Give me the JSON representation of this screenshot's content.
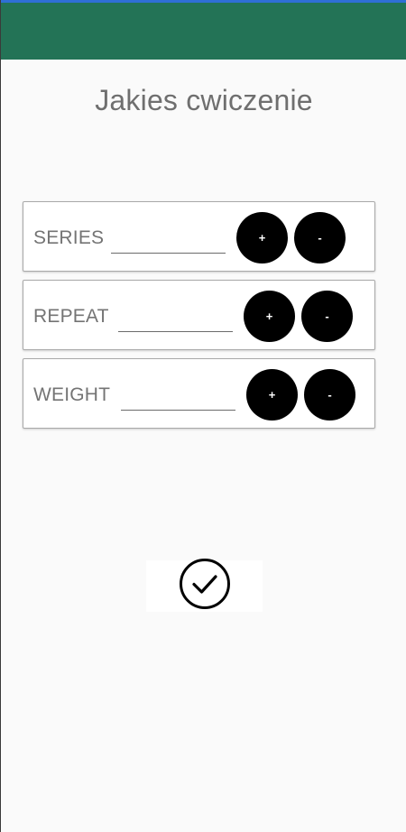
{
  "exercise_title": "Jakies cwiczenie",
  "rows": [
    {
      "label": "SERIES",
      "value": "",
      "plus_label": "+",
      "minus_label": "-"
    },
    {
      "label": "REPEAT",
      "value": "",
      "plus_label": "+",
      "minus_label": "-"
    },
    {
      "label": "WEIGHT",
      "value": "",
      "plus_label": "+",
      "minus_label": "-"
    }
  ],
  "confirm_icon": "check-circle-icon",
  "colors": {
    "app_bar": "#237356",
    "status_accent": "#2f6fd6",
    "button": "#000000"
  }
}
